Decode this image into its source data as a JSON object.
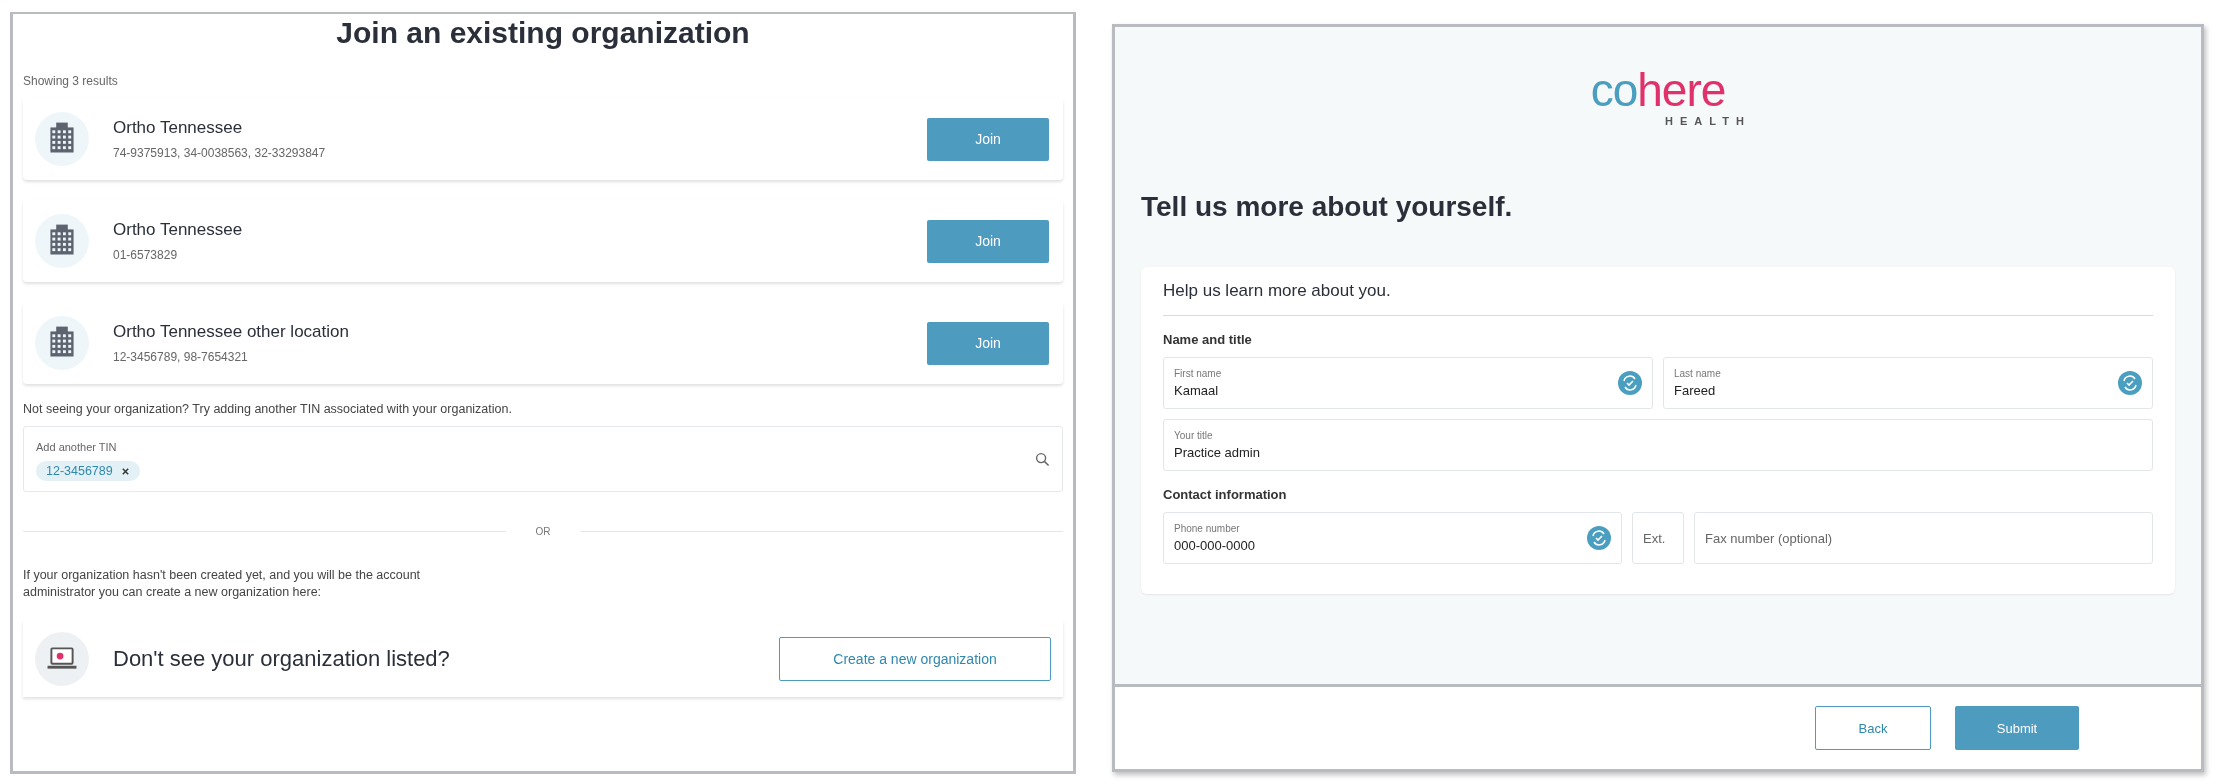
{
  "join_panel": {
    "title": "Join an existing organization",
    "results_count": "Showing 3 results",
    "organizations": [
      {
        "name": "Ortho Tennessee",
        "tins": "74-9375913,  34-0038563, 32-33293847",
        "action": "Join"
      },
      {
        "name": "Ortho Tennessee",
        "tins": "01-6573829",
        "action": "Join"
      },
      {
        "name": "Ortho Tennessee other location",
        "tins": "12-3456789, 98-7654321",
        "action": "Join"
      }
    ],
    "hint": "Not seeing your organization? Try adding another TIN associated with your organization.",
    "tin_field": {
      "label": "Add another TIN",
      "chips": [
        "12-3456789"
      ]
    },
    "divider_text": "OR",
    "create_text": "If your organization hasn't been created yet, and you will be the account administrator you can create a new organization here:",
    "create_heading": "Don't see your organization listed?",
    "create_button": "Create a new organization"
  },
  "profile_panel": {
    "logo": {
      "part_1": "co",
      "part_2": "here",
      "subtitle": "HEALTH"
    },
    "heading": "Tell us more about yourself.",
    "card_title": "Help us learn more about you.",
    "sections": [
      {
        "title": "Name and title",
        "rows": [
          [
            {
              "label": "First name",
              "value": "Kamaal",
              "verified": true
            },
            {
              "label": "Last name",
              "value": "Fareed",
              "verified": true
            }
          ],
          [
            {
              "label": "Your title",
              "value": "Practice admin",
              "verified": false
            }
          ]
        ]
      },
      {
        "title": "Contact information",
        "rows": [
          [
            {
              "label": "Phone number",
              "value": "000-000-0000",
              "verified": true
            },
            {
              "placeholder": "Ext.",
              "verified": false
            },
            {
              "placeholder": "Fax number (optional)",
              "verified": false
            }
          ]
        ]
      }
    ],
    "buttons": [
      {
        "label": "Back",
        "kind": "secondary"
      },
      {
        "label": "Submit",
        "kind": "primary"
      }
    ]
  }
}
